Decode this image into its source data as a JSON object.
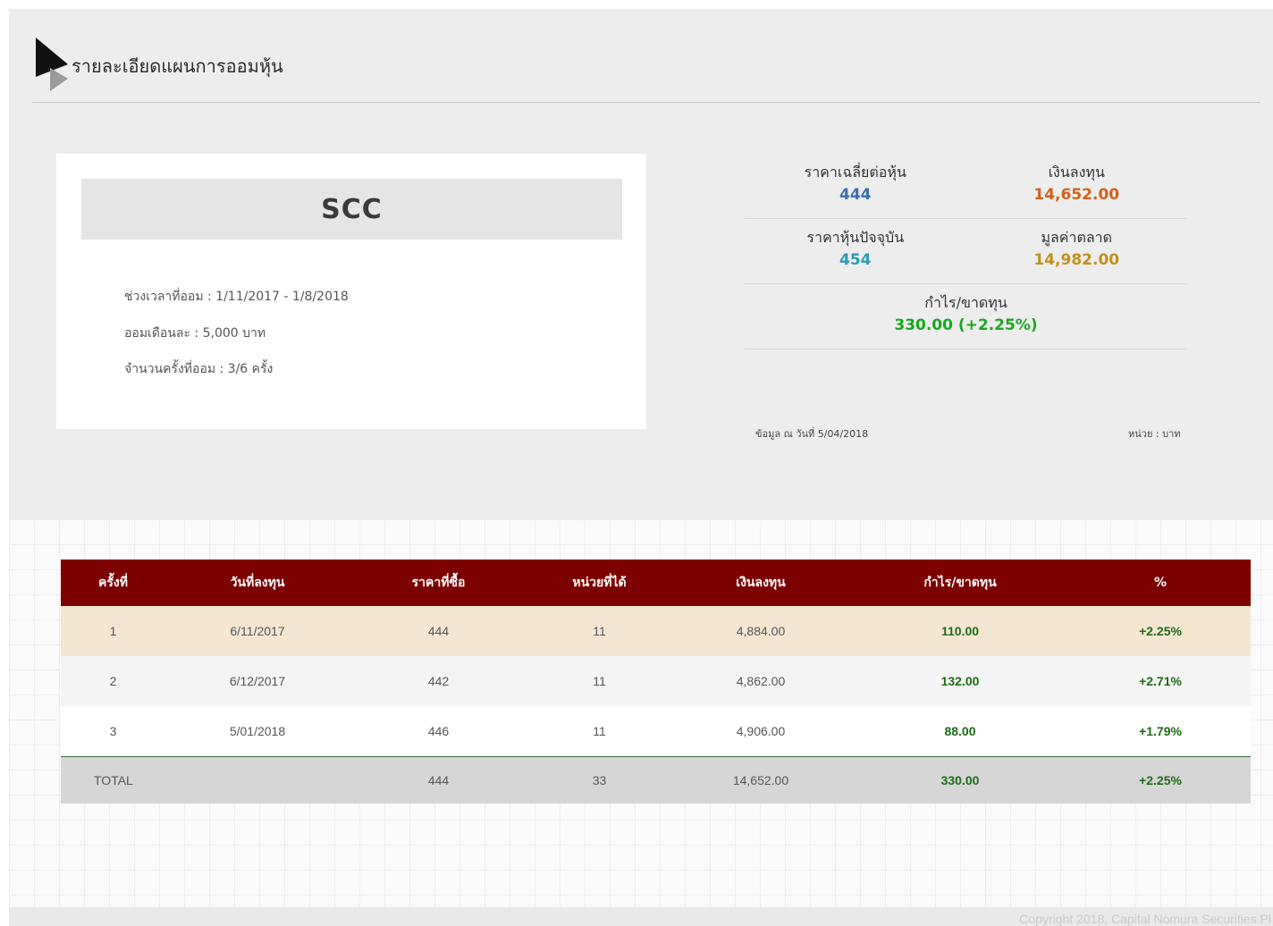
{
  "header": {
    "title": "รายละเอียดแผนการออมหุ้น",
    "logo_icon": "play-arrow-logo-icon"
  },
  "plan": {
    "symbol": "SCC",
    "period_label": "ช่วงเวลาที่ออม : 1/11/2017 - 1/8/2018",
    "monthly_label": "ออมเดือนละ : 5,000 บาท",
    "count_label": "จำนวนครั้งที่ออม : 3/6 ครั้ง"
  },
  "stats": {
    "avg_price_label": "ราคาเฉลี่ยต่อหุ้น",
    "avg_price_value": "444",
    "investment_label": "เงินลงทุน",
    "investment_value": "14,652.00",
    "current_price_label": "ราคาหุ้นปัจจุบัน",
    "current_price_value": "454",
    "market_value_label": "มูลค่าตลาด",
    "market_value_value": "14,982.00",
    "pnl_label": "กำไร/ขาดทุน",
    "pnl_value": "330.00 (+2.25%)",
    "as_of_label": "ข้อมูล ณ วันที่ 5/04/2018",
    "unit_label": "หน่วย : บาท"
  },
  "colors": {
    "avg_price": "#3b6fb0",
    "investment": "#d2601a",
    "current_price": "#2b9bb0",
    "market_value": "#c3901b",
    "pnl": "#19a81f",
    "table_header": "#7d0000",
    "positive": "#1d6b16"
  },
  "table": {
    "headers": [
      "ครั้งที่",
      "วันที่ลงทุน",
      "ราคาที่ซื้อ",
      "หน่วยที่ได้",
      "เงินลงทุน",
      "กำไร/ขาดทุน",
      "%"
    ],
    "rows": [
      [
        "1",
        "6/11/2017",
        "444",
        "11",
        "4,884.00",
        "110.00",
        "+2.25%"
      ],
      [
        "2",
        "6/12/2017",
        "442",
        "11",
        "4,862.00",
        "132.00",
        "+2.71%"
      ],
      [
        "3",
        "5/01/2018",
        "446",
        "11",
        "4,906.00",
        "88.00",
        "+1.79%"
      ]
    ],
    "total": [
      "TOTAL",
      "",
      "444",
      "33",
      "14,652.00",
      "330.00",
      "+2.25%"
    ]
  },
  "footer": {
    "copyright": "Copyright 2018, Capital Nomura Securities Pl"
  }
}
